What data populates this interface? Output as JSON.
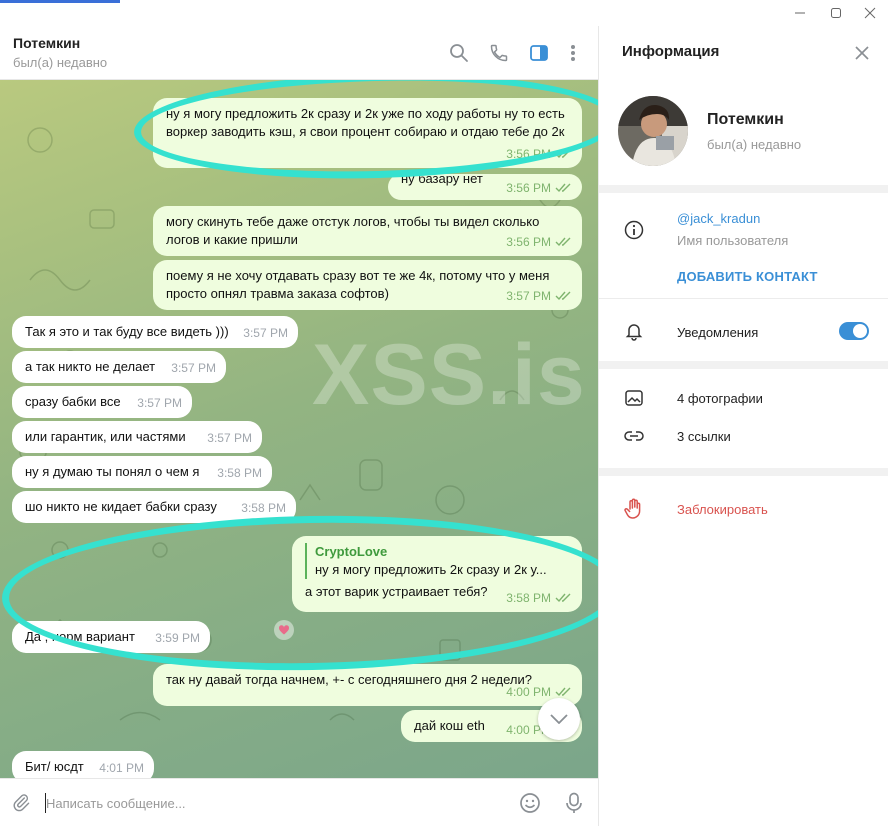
{
  "window": {
    "controls": [
      "minimize-icon",
      "maximize-icon",
      "close-icon"
    ]
  },
  "chat_header": {
    "name": "Потемкин",
    "status": "был(а) недавно",
    "icons": [
      "search-icon",
      "phone-icon",
      "sidebar-toggle-icon",
      "more-icon"
    ]
  },
  "watermark": "XSS.is",
  "messages": [
    {
      "dir": "out",
      "text": "ну я могу предложить 2к сразу и 2к уже по ходу работы ну то есть воркер заводить кэш, я свои процент собираю и отдаю тебе до 2к",
      "time": "3:56 PM"
    },
    {
      "dir": "out",
      "text": "ну базару нет",
      "time": "3:56 PM"
    },
    {
      "dir": "out",
      "text": "могу скинуть тебе даже отстук логов, чтобы ты видел сколько логов и какие пришли",
      "time": "3:56 PM"
    },
    {
      "dir": "out",
      "text": "поему я не хочу отдавать сразу вот те же 4к, потому что у меня просто опнял травма заказа софтов)",
      "time": "3:57 PM"
    },
    {
      "dir": "in",
      "text": "Так я это и так буду все видеть )))",
      "time": "3:57 PM"
    },
    {
      "dir": "in",
      "text": "а так никто не делает",
      "time": "3:57 PM"
    },
    {
      "dir": "in",
      "text": "сразу бабки все",
      "time": "3:57 PM"
    },
    {
      "dir": "in",
      "text": "или гарантик, или частями",
      "time": "3:57 PM"
    },
    {
      "dir": "in",
      "text": "ну я думаю ты понял о чем я",
      "time": "3:58 PM"
    },
    {
      "dir": "in",
      "text": "шо никто не кидает бабки сразу",
      "time": "3:58 PM"
    },
    {
      "dir": "out",
      "reply_name": "CryptoLove",
      "reply_text": "ну я могу предложить 2к сразу и 2к у...",
      "text": "а этот варик устраивает тебя?",
      "time": "3:58 PM"
    },
    {
      "dir": "in",
      "text": "Да , норм вариант",
      "time": "3:59 PM"
    },
    {
      "dir": "out",
      "text": "так ну давай тогда начнем, +- с сегодняшнего дня 2 недели?",
      "time": "4:00 PM"
    },
    {
      "dir": "out",
      "text": "дай кош eth",
      "time": "4:00 PM"
    },
    {
      "dir": "in",
      "text": "Бит/ юсдт",
      "time": "4:01 PM"
    }
  ],
  "composer": {
    "placeholder": "Написать сообщение...",
    "icons": [
      "attach-icon",
      "emoji-icon",
      "microphone-icon"
    ]
  },
  "info_panel": {
    "title": "Информация",
    "name": "Потемкин",
    "status": "был(а) недавно",
    "username": "@jack_kradun",
    "username_label": "Имя пользователя",
    "add_contact": "ДОБАВИТЬ КОНТАКТ",
    "notifications_label": "Уведомления",
    "notifications_on": true,
    "photos": "4 фотографии",
    "links": "3 ссылки",
    "block": "Заблокировать"
  },
  "colors": {
    "accent": "#3a8fd6",
    "outgoing_bubble": "#effdde",
    "incoming_bubble": "#ffffff",
    "annotation_ring": "#35e1cf",
    "danger": "#d9534f"
  }
}
